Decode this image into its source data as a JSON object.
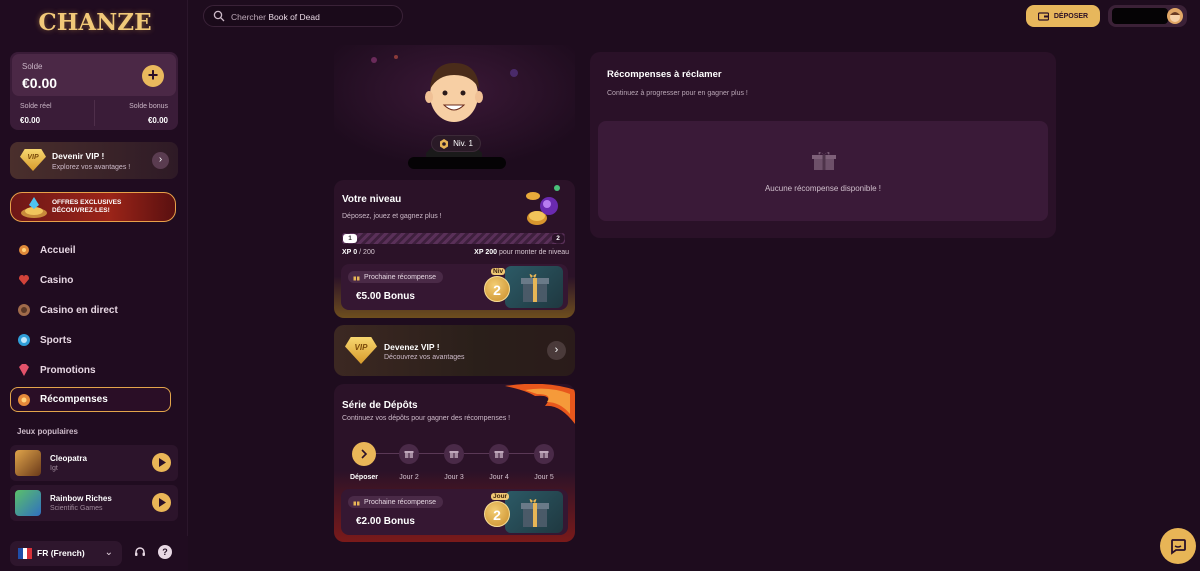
{
  "header": {
    "logo_text": "CHANZE",
    "search": {
      "prefix": "Chercher",
      "query": "Book of Dead"
    },
    "deposit_label": "DÉPOSER"
  },
  "sidebar": {
    "balance": {
      "label": "Solde",
      "value": "€0.00",
      "real_label": "Solde réel",
      "real_value": "€0.00",
      "bonus_label": "Solde bonus",
      "bonus_value": "€0.00"
    },
    "vip": {
      "badge": "VIP",
      "title": "Devenir VIP !",
      "subtitle": "Explorez vos avantages !"
    },
    "promo_banner": {
      "line1": "OFFRES EXCLUSIVES",
      "line2": "DÉCOUVREZ-LES!"
    },
    "nav": [
      {
        "label": "Accueil",
        "icon": "home-icon"
      },
      {
        "label": "Casino",
        "icon": "casino-icon"
      },
      {
        "label": "Casino en direct",
        "icon": "live-casino-icon"
      },
      {
        "label": "Sports",
        "icon": "sports-icon"
      },
      {
        "label": "Promotions",
        "icon": "promotions-icon"
      },
      {
        "label": "Récompenses",
        "icon": "rewards-icon",
        "active": true
      }
    ],
    "popular_label": "Jeux populaires",
    "games": [
      {
        "name": "Cleopatra",
        "provider": "Igt"
      },
      {
        "name": "Rainbow Riches",
        "provider": "Scientific Games"
      }
    ],
    "language": "FR (French)"
  },
  "level": {
    "badge": "Niv. 1",
    "title": "Votre niveau",
    "subtitle": "Déposez, jouez et gagnez plus !",
    "xp_start": "1",
    "xp_end": "2",
    "xp_progress": 0,
    "xp_current_label": "XP",
    "xp_current": "0",
    "xp_max": "/ 200",
    "xp_needed": "XP 200",
    "xp_needed_suffix": "pour monter de niveau",
    "next_reward_label": "Prochaine récompense",
    "next_reward_value": "€5.00 Bonus",
    "next_reward_badge_tag": "Niv",
    "next_reward_badge": "2"
  },
  "vip_banner": {
    "badge": "VIP",
    "title": "Devenez VIP !",
    "subtitle": "Découvrez vos avantages"
  },
  "streak": {
    "title": "Série de Dépôts",
    "subtitle": "Continuez vos dépôts pour gagner des récompenses !",
    "steps": [
      "Déposer",
      "Jour 2",
      "Jour 3",
      "Jour 4",
      "Jour 5"
    ],
    "next_reward_label": "Prochaine récompense",
    "next_reward_value": "€2.00 Bonus",
    "badge_tag": "Jour",
    "badge": "2"
  },
  "rewards_panel": {
    "title": "Récompenses à réclamer",
    "subtitle": "Continuez à progresser pour en gagner plus !",
    "empty_text": "Aucune récompense disponible !"
  },
  "colors": {
    "accent": "#e9b658",
    "background": "#1e0c1e",
    "panel": "#2a1128"
  }
}
